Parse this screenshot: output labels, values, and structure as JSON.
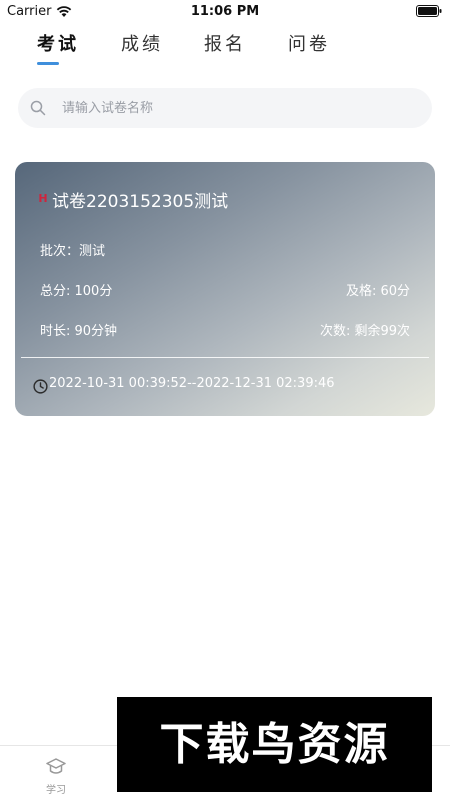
{
  "status_bar": {
    "carrier": "Carrier",
    "time": "11:06 PM"
  },
  "tabs": [
    {
      "label": "考试",
      "active": true
    },
    {
      "label": "成绩",
      "active": false
    },
    {
      "label": "报名",
      "active": false
    },
    {
      "label": "问卷",
      "active": false
    }
  ],
  "colors": {
    "accent": "#3f8fdc",
    "badge": "#d0243c"
  },
  "search": {
    "placeholder": "请输入试卷名称"
  },
  "exam_card": {
    "badge": "H",
    "title": "试卷2203152305测试",
    "batch": "批次：测试",
    "total_score": "总分: 100分",
    "pass_score": "及格: 60分",
    "duration": "时长: 90分钟",
    "attempts": "次数: 剩余99次",
    "time_range": "2022-10-31 00:39:52--2022-12-31 02:39:46"
  },
  "bottom_nav": {
    "items": [
      {
        "label": "学习",
        "icon": "graduation-cap-icon"
      }
    ]
  },
  "watermark": {
    "text": "下载鸟资源"
  }
}
